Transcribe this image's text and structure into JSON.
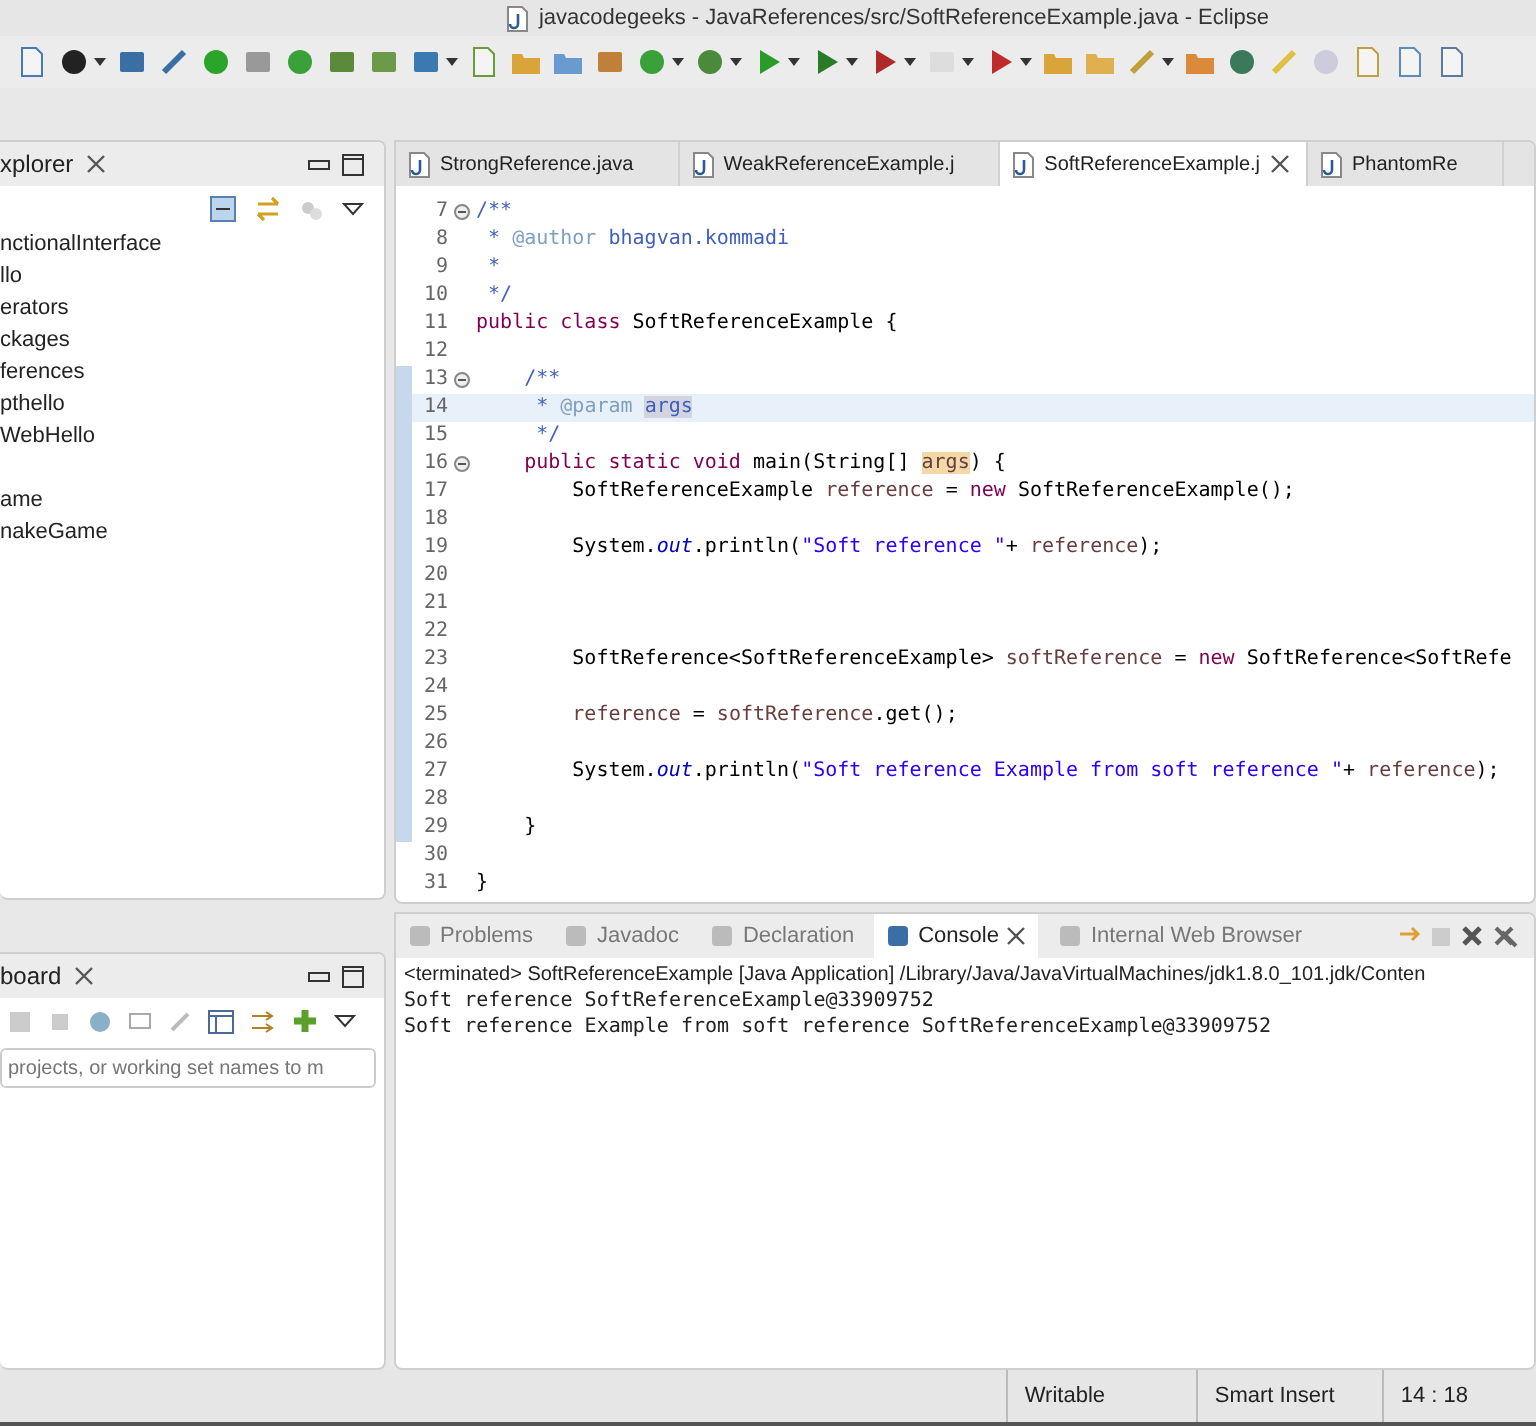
{
  "window": {
    "title": "javacodegeeks - JavaReferences/src/SoftReferenceExample.java - Eclipse"
  },
  "explorer": {
    "title": "xplorer",
    "items": [
      {
        "label": "nctionalInterface"
      },
      {
        "label": "llo"
      },
      {
        "label": "erators"
      },
      {
        "label": "ckages"
      },
      {
        "label": "ferences"
      },
      {
        "label": "pthello"
      },
      {
        "label": "WebHello"
      },
      {
        "label": "ame"
      },
      {
        "label": "nakeGame"
      }
    ]
  },
  "dashboard": {
    "title": "board",
    "search": {
      "placeholder": "projects, or working set names to m"
    }
  },
  "editor": {
    "tabs": [
      {
        "label": "StrongReference.java",
        "selected": false
      },
      {
        "label": "WeakReferenceExample.j",
        "selected": false
      },
      {
        "label": "SoftReferenceExample.j",
        "selected": true
      },
      {
        "label": "PhantomRe",
        "selected": false
      }
    ],
    "lines": [
      {
        "number": "7",
        "foldable": true,
        "changed": false,
        "current": false,
        "tokens": [
          {
            "kind": "comment",
            "text": "/**"
          }
        ]
      },
      {
        "number": "8",
        "foldable": false,
        "changed": false,
        "current": false,
        "tokens": [
          {
            "kind": "comment",
            "text": " * "
          },
          {
            "kind": "doctag",
            "text": "@author"
          },
          {
            "kind": "comment",
            "text": " bhagvan.kommadi"
          }
        ]
      },
      {
        "number": "9",
        "foldable": false,
        "changed": false,
        "current": false,
        "tokens": [
          {
            "kind": "comment",
            "text": " *"
          }
        ]
      },
      {
        "number": "10",
        "foldable": false,
        "changed": false,
        "current": false,
        "tokens": [
          {
            "kind": "comment",
            "text": " */"
          }
        ]
      },
      {
        "number": "11",
        "foldable": false,
        "changed": false,
        "current": false,
        "tokens": [
          {
            "kind": "keyword",
            "text": "public class"
          },
          {
            "kind": "plain",
            "text": " SoftReferenceExample {"
          }
        ]
      },
      {
        "number": "12",
        "foldable": false,
        "changed": false,
        "current": false
      },
      {
        "number": "13",
        "foldable": true,
        "changed": true,
        "current": false,
        "tokens": [
          {
            "kind": "comment",
            "text": "    /**"
          }
        ]
      },
      {
        "number": "14",
        "foldable": false,
        "changed": true,
        "current": true,
        "tokens": [
          {
            "kind": "comment",
            "text": "     * "
          },
          {
            "kind": "doctag",
            "text": "@param "
          },
          {
            "kind": "selected",
            "text": "args"
          }
        ]
      },
      {
        "number": "15",
        "foldable": false,
        "changed": true,
        "current": false,
        "tokens": [
          {
            "kind": "comment",
            "text": "     */"
          }
        ]
      },
      {
        "number": "16",
        "foldable": true,
        "changed": true,
        "current": false,
        "tokens": [
          {
            "kind": "keyword",
            "text": "    public static void"
          },
          {
            "kind": "plain",
            "text": " main(String[] "
          },
          {
            "kind": "occurrence",
            "text": "args"
          },
          {
            "kind": "plain",
            "text": ") {"
          }
        ]
      },
      {
        "number": "17",
        "foldable": false,
        "changed": true,
        "current": false,
        "tokens": [
          {
            "kind": "plain",
            "text": "        SoftReferenceExample "
          },
          {
            "kind": "variable",
            "text": "reference"
          },
          {
            "kind": "plain",
            "text": " = "
          },
          {
            "kind": "keyword",
            "text": "new"
          },
          {
            "kind": "plain",
            "text": " SoftReferenceExample();"
          }
        ]
      },
      {
        "number": "18",
        "foldable": false,
        "changed": true,
        "current": false
      },
      {
        "number": "19",
        "foldable": false,
        "changed": true,
        "current": false,
        "tokens": [
          {
            "kind": "plain",
            "text": "        System."
          },
          {
            "kind": "field",
            "text": "out"
          },
          {
            "kind": "plain",
            "text": ".println("
          },
          {
            "kind": "string",
            "text": "\"Soft reference \""
          },
          {
            "kind": "plain",
            "text": "+ "
          },
          {
            "kind": "variable",
            "text": "reference"
          },
          {
            "kind": "plain",
            "text": ");"
          }
        ]
      },
      {
        "number": "20",
        "foldable": false,
        "changed": true,
        "current": false
      },
      {
        "number": "21",
        "foldable": false,
        "changed": true,
        "current": false
      },
      {
        "number": "22",
        "foldable": false,
        "changed": true,
        "current": false
      },
      {
        "number": "23",
        "foldable": false,
        "changed": true,
        "current": false,
        "tokens": [
          {
            "kind": "plain",
            "text": "        SoftReference<SoftReferenceExample> "
          },
          {
            "kind": "variable",
            "text": "softReference"
          },
          {
            "kind": "plain",
            "text": " = "
          },
          {
            "kind": "keyword",
            "text": "new"
          },
          {
            "kind": "plain",
            "text": " SoftReference<SoftRefe"
          }
        ]
      },
      {
        "number": "24",
        "foldable": false,
        "changed": true,
        "current": false
      },
      {
        "number": "25",
        "foldable": false,
        "changed": true,
        "current": false,
        "tokens": [
          {
            "kind": "variable",
            "text": "        reference"
          },
          {
            "kind": "plain",
            "text": " = "
          },
          {
            "kind": "variable",
            "text": "softReference"
          },
          {
            "kind": "plain",
            "text": ".get();"
          }
        ]
      },
      {
        "number": "26",
        "foldable": false,
        "changed": true,
        "current": false
      },
      {
        "number": "27",
        "foldable": false,
        "changed": true,
        "current": false,
        "tokens": [
          {
            "kind": "plain",
            "text": "        System."
          },
          {
            "kind": "field",
            "text": "out"
          },
          {
            "kind": "plain",
            "text": ".println("
          },
          {
            "kind": "string",
            "text": "\"Soft reference Example from soft reference \""
          },
          {
            "kind": "plain",
            "text": "+ "
          },
          {
            "kind": "variable",
            "text": "reference"
          },
          {
            "kind": "plain",
            "text": ");"
          }
        ]
      },
      {
        "number": "28",
        "foldable": false,
        "changed": true,
        "current": false
      },
      {
        "number": "29",
        "foldable": false,
        "changed": true,
        "current": false,
        "tokens": [
          {
            "kind": "plain",
            "text": "    }"
          }
        ]
      },
      {
        "number": "30",
        "foldable": false,
        "changed": false,
        "current": false
      },
      {
        "number": "31",
        "foldable": false,
        "changed": false,
        "current": false,
        "tokens": [
          {
            "kind": "plain",
            "text": "}"
          }
        ]
      }
    ]
  },
  "console": {
    "tabs": [
      {
        "label": "Problems",
        "selected": false
      },
      {
        "label": "Javadoc",
        "selected": false
      },
      {
        "label": "Declaration",
        "selected": false
      },
      {
        "label": "Console",
        "selected": true
      },
      {
        "label": "Internal Web Browser",
        "selected": false
      }
    ],
    "header": "<terminated> SoftReferenceExample [Java Application] /Library/Java/JavaVirtualMachines/jdk1.8.0_101.jdk/Conten",
    "output": [
      "Soft reference SoftReferenceExample@33909752",
      "Soft reference Example from soft reference SoftReferenceExample@33909752"
    ]
  },
  "status_bar": {
    "fields": [
      "Writable",
      "Smart Insert",
      "14 : 18"
    ]
  }
}
